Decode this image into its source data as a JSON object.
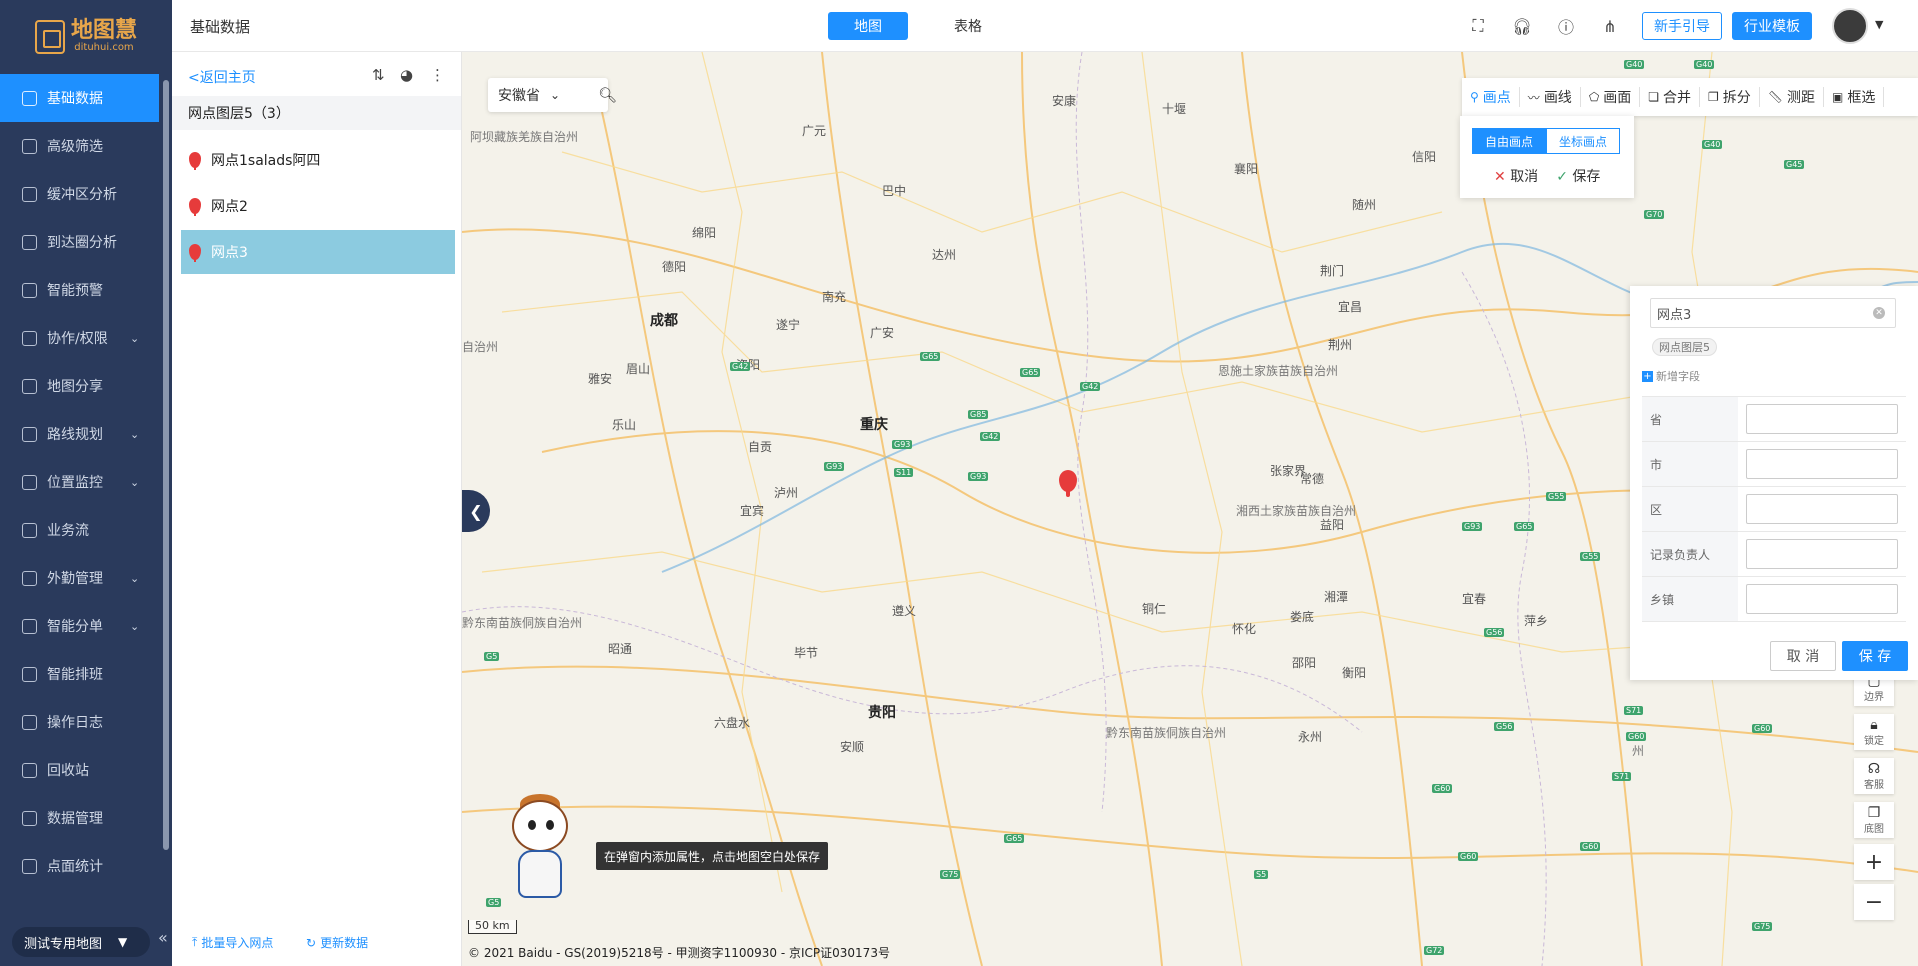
{
  "logo": {
    "name": "地图慧",
    "sub": "dituhui.com"
  },
  "sidebar": {
    "items": [
      {
        "label": "基础数据",
        "icon": "list-icon"
      },
      {
        "label": "高级筛选",
        "icon": "filter-icon"
      },
      {
        "label": "缓冲区分析",
        "icon": "target-icon"
      },
      {
        "label": "到达圈分析",
        "icon": "clock-icon"
      },
      {
        "label": "智能预警",
        "icon": "alarm-icon"
      },
      {
        "label": "协作/权限",
        "icon": "user-icon"
      },
      {
        "label": "地图分享",
        "icon": "share-icon"
      },
      {
        "label": "路线规划",
        "icon": "route-icon"
      },
      {
        "label": "位置监控",
        "icon": "location-icon"
      },
      {
        "label": "业务流",
        "icon": "flow-icon"
      },
      {
        "label": "外勤管理",
        "icon": "field-icon"
      },
      {
        "label": "智能分单",
        "icon": "order-icon"
      },
      {
        "label": "智能排班",
        "icon": "calendar-icon"
      },
      {
        "label": "操作日志",
        "icon": "log-icon"
      },
      {
        "label": "回收站",
        "icon": "trash-icon"
      },
      {
        "label": "数据管理",
        "icon": "database-icon"
      },
      {
        "label": "点面统计",
        "icon": "stats-icon"
      }
    ],
    "map_select": "测试专用地图",
    "accent": "#1e90ff",
    "bg": "#2a3a5c"
  },
  "topbar": {
    "title": "基础数据",
    "tab_map": "地图",
    "tab_table": "表格",
    "guide": "新手引导",
    "template": "行业模板"
  },
  "layer_panel": {
    "back": "<返回主页",
    "layer_name": "网点图层5（3）",
    "points": [
      "网点1salads阿四",
      "网点2",
      "网点3"
    ],
    "import": "批量导入网点",
    "refresh": "更新数据"
  },
  "map": {
    "province": "安徽省",
    "cities": [
      {
        "name": "成都",
        "big": true
      },
      {
        "name": "重庆",
        "big": true
      },
      {
        "name": "贵阳",
        "big": true
      },
      {
        "name": "广元"
      },
      {
        "name": "巴中"
      },
      {
        "name": "安康"
      },
      {
        "name": "十堰"
      },
      {
        "name": "襄阳"
      },
      {
        "name": "绵阳"
      },
      {
        "name": "德阳"
      },
      {
        "name": "南充"
      },
      {
        "name": "达州"
      },
      {
        "name": "遂宁"
      },
      {
        "name": "广安"
      },
      {
        "name": "资阳"
      },
      {
        "name": "眉山"
      },
      {
        "name": "雅安"
      },
      {
        "name": "乐山"
      },
      {
        "name": "自贡"
      },
      {
        "name": "泸州"
      },
      {
        "name": "宜宾"
      },
      {
        "name": "遵义"
      },
      {
        "name": "铜仁"
      },
      {
        "name": "怀化"
      },
      {
        "name": "张家界"
      },
      {
        "name": "常德"
      },
      {
        "name": "益阳"
      },
      {
        "name": "湘潭"
      },
      {
        "name": "娄底"
      },
      {
        "name": "邵阳"
      },
      {
        "name": "衡阳"
      },
      {
        "name": "永州"
      },
      {
        "name": "宜昌"
      },
      {
        "name": "荆门"
      },
      {
        "name": "荆州"
      },
      {
        "name": "随州"
      },
      {
        "name": "信阳"
      },
      {
        "name": "毕节"
      },
      {
        "name": "昭通"
      },
      {
        "name": "六盘水"
      },
      {
        "name": "安顺"
      },
      {
        "name": "宜春"
      },
      {
        "name": "萍乡"
      }
    ],
    "regions": [
      "阿坝藏族羌族自治州",
      "恩施土家族苗族自治州",
      "湘西土家族苗族自治州",
      "黔东南苗族侗族自治州",
      "黔东南苗族侗族自治州",
      "自治州",
      "州"
    ],
    "highways": [
      "G40",
      "G40",
      "G40",
      "G45",
      "G40",
      "G70",
      "G55",
      "G5",
      "G42",
      "G42",
      "G65",
      "G65",
      "G42",
      "G93",
      "G93",
      "G85",
      "S11",
      "G93",
      "G55",
      "G65",
      "G56",
      "G55",
      "G60",
      "G5",
      "S71",
      "G60",
      "G60",
      "G60",
      "G75",
      "G65",
      "S71",
      "G75",
      "G72",
      "G60",
      "S5",
      "G56",
      "G93"
    ],
    "tooltip": "在弹窗内添加属性，点击地图空白处保存",
    "scale": "50 km",
    "copyright": "© 2021 Baidu - GS(2019)5218号 - 甲测资字1100930 - 京ICP证030173号"
  },
  "draw_toolbar": {
    "items": [
      "画点",
      "画线",
      "画面",
      "合并",
      "拆分",
      "测距",
      "框选"
    ],
    "mode_free": "自由画点",
    "mode_coord": "坐标画点",
    "cancel": "取消",
    "save": "保存"
  },
  "side_controls": [
    "边界",
    "锁定",
    "客服",
    "底图"
  ],
  "attr_panel": {
    "name_value": "网点3",
    "tag": "网点图层5",
    "add_field": "新增字段",
    "fields": [
      "省",
      "市",
      "区",
      "记录负责人",
      "乡镇"
    ],
    "cancel": "取 消",
    "save": "保 存"
  }
}
